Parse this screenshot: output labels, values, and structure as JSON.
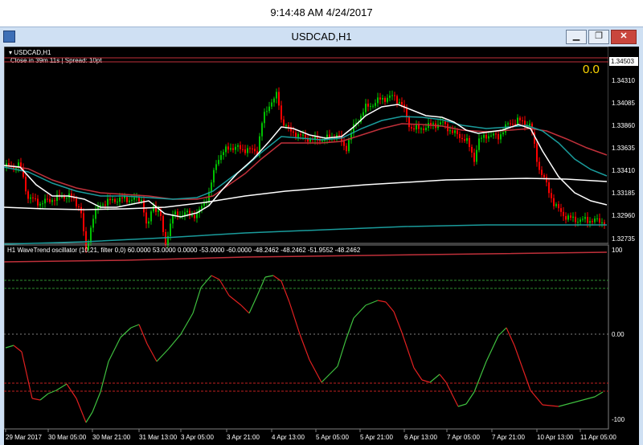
{
  "timestamp": "9:14:48 AM 4/24/2017",
  "window": {
    "title": "USDCAD,H1",
    "controls": {
      "minimize": "▁",
      "restore": "❐",
      "close": "✕"
    }
  },
  "price_panel": {
    "symbol_label": "USDCAD,H1",
    "info": "Close in 39m 11s | Spread: 10pt",
    "big_value": "0.0",
    "current_price": "1.34503",
    "price_ticks": [
      "1.34310",
      "1.34085",
      "1.33860",
      "1.33635",
      "1.33410",
      "1.33185",
      "1.32960",
      "1.32735"
    ]
  },
  "oscillator_panel": {
    "label": "H1 WaveTrend oscillator (10,21, filter 0,0) 60.0000 53.0000 0.0000 -53.0000 -60.0000 -48.2462 -48.2462 -51.9552 -48.2462",
    "ticks": [
      "100",
      "0.00",
      "-100"
    ]
  },
  "time_axis": [
    "29 Mar 2017",
    "30 Mar 05:00",
    "30 Mar 21:00",
    "31 Mar 13:00",
    "3 Apr 05:00",
    "3 Apr 21:00",
    "4 Apr 13:00",
    "5 Apr 05:00",
    "5 Apr 21:00",
    "6 Apr 13:00",
    "7 Apr 05:00",
    "7 Apr 21:00",
    "10 Apr 13:00",
    "11 Apr 05:00"
  ],
  "colors": {
    "background": "#000000",
    "bull_candle": "#00c000",
    "bear_candle": "#ff0000",
    "ma_white": "#ffffff",
    "ma_teal": "#1a9c9c",
    "ma_red": "#c0303a",
    "osc_green": "#3fbf3f",
    "osc_red": "#e02020",
    "level_green": "#2e8b2e",
    "level_red": "#c02020",
    "big_value": "#ffd700"
  }
}
